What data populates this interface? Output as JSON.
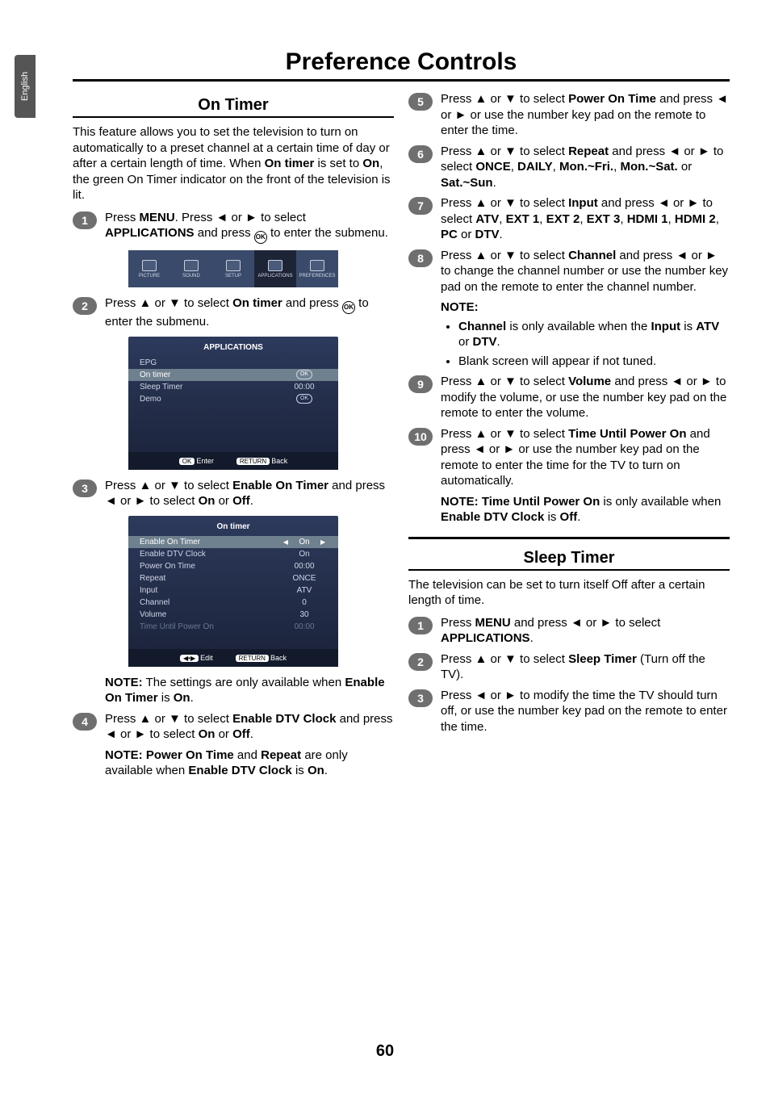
{
  "lang_tab": "English",
  "title": "Preference Controls",
  "left": {
    "section": "On Timer",
    "lead": "This feature allows you to set the television to turn on automatically to a preset channel at a certain time of day or after a certain length of time. When <strong>On timer</strong> is set to <strong>On</strong>, the green On Timer indicator on the front of the television is lit.",
    "s1": "Press <strong>MENU</strong>. Press ◄ or ► to select <strong>APPLICATIONS</strong> and press <span class='okcirc'>OK</span> to enter the submenu.",
    "s2": "Press ▲ or ▼ to select <strong>On timer</strong> and press <span class='okcirc'>OK</span> to enter the submenu.",
    "s3": "Press ▲ or ▼ to select <strong>Enable On Timer</strong> and press ◄ or ► to select <strong>On</strong> or <strong>Off</strong>.",
    "s3_note": "<strong>NOTE:</strong> The settings are only available when <strong>Enable On Timer</strong> is <strong>On</strong>.",
    "s4": "Press ▲ or ▼ to select <strong>Enable DTV Clock</strong> and press ◄ or ► to select <strong>On</strong> or <strong>Off</strong>.",
    "s4_note": "<strong>NOTE: Power On Time</strong> and <strong>Repeat</strong> are only available when <strong>Enable DTV Clock</strong> is <strong>On</strong>."
  },
  "right": {
    "s5": "Press ▲ or ▼ to select <strong>Power On Time</strong> and press ◄ or ► or use the number key pad on the remote to enter the time.",
    "s6": "Press ▲ or ▼ to select <strong>Repeat</strong> and press ◄ or ► to select <strong>ONCE</strong>, <strong>DAILY</strong>, <strong>Mon.~Fri.</strong>, <strong>Mon.~Sat.</strong> or <strong>Sat.~Sun</strong>.",
    "s7": "Press ▲ or ▼ to select <strong>Input</strong> and press ◄ or ► to select <strong>ATV</strong>, <strong>EXT 1</strong>, <strong>EXT 2</strong>, <strong>EXT 3</strong>, <strong>HDMI 1</strong>, <strong>HDMI 2</strong>, <strong>PC</strong> or <strong>DTV</strong>.",
    "s8": "Press ▲ or ▼ to select <strong>Channel</strong> and press ◄ or ► to change the channel number or use the number key pad on the remote to enter the channel number.",
    "note_label": "NOTE:",
    "note_b1": "<strong>Channel</strong> is only available when the <strong>Input</strong> is <strong>ATV</strong> or <strong>DTV</strong>.",
    "note_b2": "Blank screen will appear if not tuned.",
    "s9": "Press ▲ or ▼ to select <strong>Volume</strong> and press ◄ or ► to modify the volume, or use the number key pad on the remote to enter the volume.",
    "s10": "Press ▲ or ▼ to select <strong>Time Until Power On</strong> and press ◄ or ► or use the number key pad on the remote to enter the time for the TV to turn on automatically.",
    "s10_note": "<strong>NOTE: Time Until Power On</strong> is only available when <strong>Enable DTV Clock</strong> is <strong>Off</strong>.",
    "section2": "Sleep Timer",
    "lead2": "The television can be set to turn itself Off after a certain length of time.",
    "st1": "Press <strong>MENU</strong> and press ◄ or ► to select <strong>APPLICATIONS</strong>.",
    "st2": "Press ▲ or ▼ to select <strong>Sleep Timer</strong> (Turn off the TV).",
    "st3": "Press ◄ or ► to modify the time the TV should turn off, or use the number key pad on the remote to enter the time."
  },
  "menu_strip": {
    "items": [
      "PICTURE",
      "SOUND",
      "SETUP",
      "APPLICATIONS",
      "PREFERENCES"
    ],
    "selected": 3
  },
  "panel1": {
    "title": "APPLICATIONS",
    "rows": [
      {
        "lab": "EPG",
        "val": ""
      },
      {
        "lab": "On timer",
        "val": "OK",
        "sel": true,
        "pill": true
      },
      {
        "lab": "Sleep Timer",
        "val": "00:00"
      },
      {
        "lab": "Demo",
        "val": "OK",
        "pill": true
      }
    ],
    "foot_left_pill": "OK",
    "foot_left": "Enter",
    "foot_right_pill": "RETURN",
    "foot_right": "Back"
  },
  "panel2": {
    "title": "On timer",
    "rows": [
      {
        "lab": "Enable On Timer",
        "val": "On",
        "sel": true,
        "arrows": true
      },
      {
        "lab": "Enable DTV Clock",
        "val": "On"
      },
      {
        "lab": "Power On Time",
        "val": "00:00"
      },
      {
        "lab": "Repeat",
        "val": "ONCE"
      },
      {
        "lab": "Input",
        "val": "ATV"
      },
      {
        "lab": "Channel",
        "val": "0"
      },
      {
        "lab": "Volume",
        "val": "30"
      },
      {
        "lab": "Time Until Power On",
        "val": "00:00",
        "dis": true
      }
    ],
    "foot_left_pill": "◀•▶",
    "foot_left": "Edit",
    "foot_right_pill": "RETURN",
    "foot_right": "Back"
  },
  "page_num": "60"
}
